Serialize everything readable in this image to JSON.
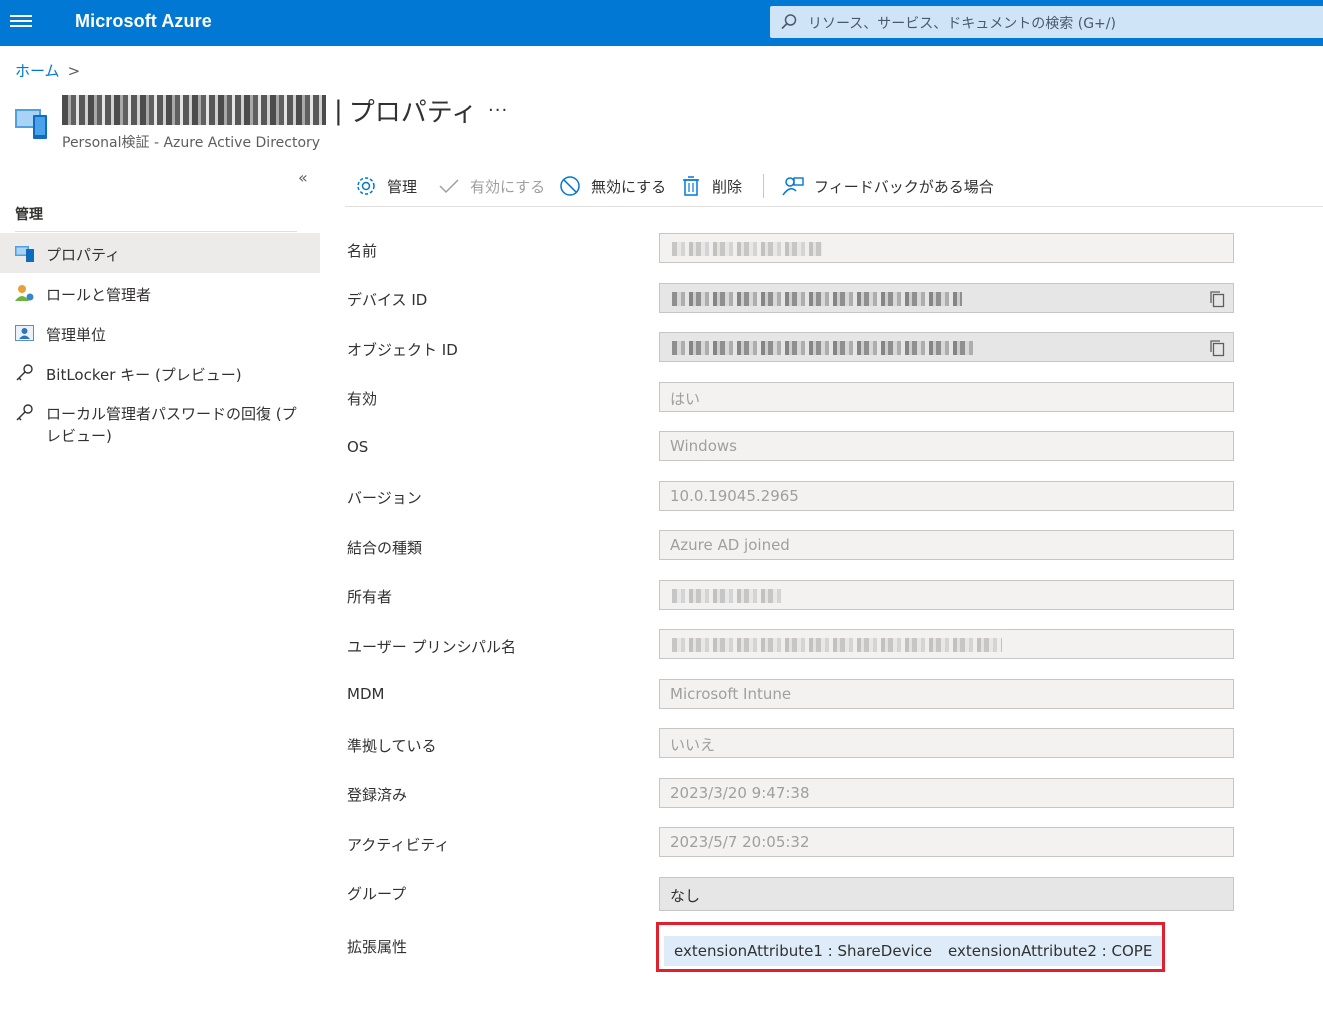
{
  "app": {
    "brand": "Microsoft Azure",
    "search_placeholder": "リソース、サービス、ドキュメントの検索 (G+/)"
  },
  "breadcrumb": {
    "home": "ホーム",
    "separator": ">"
  },
  "header": {
    "title_separator": "|",
    "title_suffix": "プロパティ",
    "more": "···",
    "subtitle": "Personal検証 - Azure Active Directory"
  },
  "sidebar": {
    "collapse": "«",
    "heading": "管理",
    "items": [
      {
        "label": "プロパティ",
        "icon": "device-icon",
        "active": true
      },
      {
        "label": "ロールと管理者",
        "icon": "user-role-icon"
      },
      {
        "label": "管理単位",
        "icon": "admin-unit-icon"
      },
      {
        "label": "BitLocker キー (プレビュー)",
        "icon": "key-icon"
      },
      {
        "label": "ローカル管理者パスワードの回復 (プレビュー)",
        "icon": "key-icon"
      }
    ]
  },
  "toolbar": {
    "manage": "管理",
    "enable": "有効にする",
    "disable": "無効にする",
    "delete": "削除",
    "feedback": "フィードバックがある場合"
  },
  "properties": {
    "name": {
      "label": "名前"
    },
    "device_id": {
      "label": "デバイス ID"
    },
    "object_id": {
      "label": "オブジェクト ID"
    },
    "enabled": {
      "label": "有効",
      "value": "はい"
    },
    "os": {
      "label": "OS",
      "value": "Windows"
    },
    "version": {
      "label": "バージョン",
      "value": "10.0.19045.2965"
    },
    "join_type": {
      "label": "結合の種類",
      "value": "Azure AD joined"
    },
    "owner": {
      "label": "所有者"
    },
    "upn": {
      "label": "ユーザー プリンシパル名"
    },
    "mdm": {
      "label": "MDM",
      "value": "Microsoft Intune"
    },
    "compliant": {
      "label": "準拠している",
      "value": "いいえ"
    },
    "registered": {
      "label": "登録済み",
      "value": "2023/3/20 9:47:38"
    },
    "activity": {
      "label": "アクティビティ",
      "value": "2023/5/7 20:05:32"
    },
    "group": {
      "label": "グループ",
      "value": "なし"
    },
    "extension": {
      "label": "拡張属性",
      "attr1": "extensionAttribute1 : ShareDevice",
      "attr2": "extensionAttribute2 : COPE"
    }
  },
  "colors": {
    "brand_blue": "#0078d4",
    "highlight_red": "#e0202c",
    "chip_bg": "#deecf9"
  }
}
